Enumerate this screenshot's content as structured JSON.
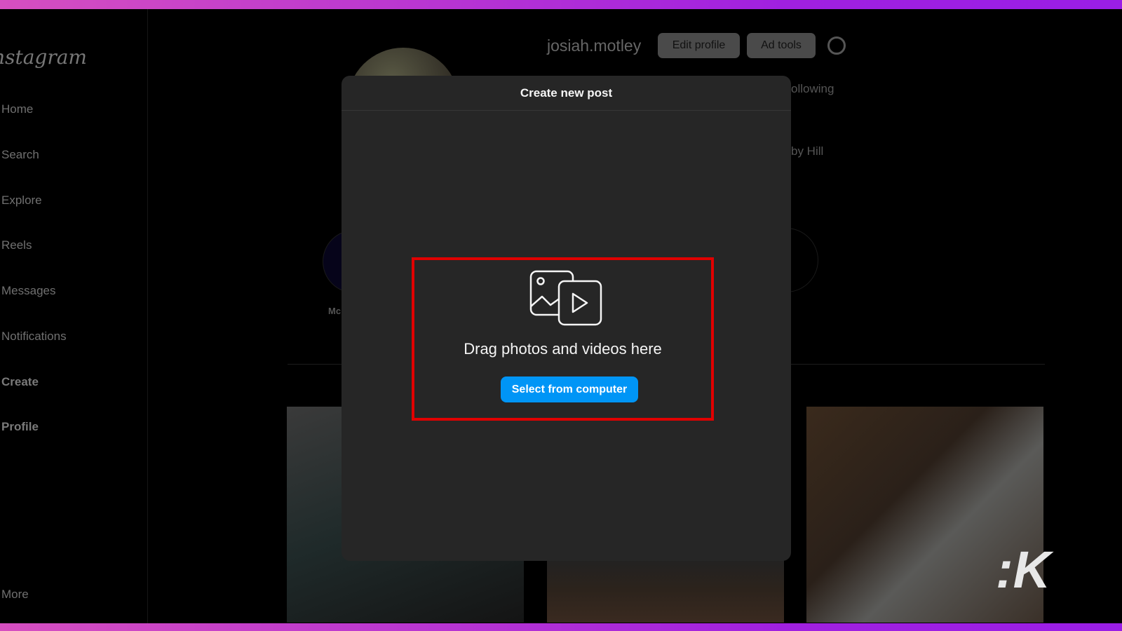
{
  "sidebar": {
    "logo": "Instagram",
    "items": [
      {
        "label": "Home"
      },
      {
        "label": "Search"
      },
      {
        "label": "Explore"
      },
      {
        "label": "Reels"
      },
      {
        "label": "Messages"
      },
      {
        "label": "Notifications"
      },
      {
        "label": "Create"
      },
      {
        "label": "Profile"
      }
    ],
    "more": "More"
  },
  "profile": {
    "username": "josiah.motley",
    "edit_profile": "Edit profile",
    "ad_tools": "Ad tools",
    "following_partial": "ollowing",
    "bio_partial": "by Hill",
    "highlight_left_partial": "Mc"
  },
  "modal": {
    "title": "Create new post",
    "drag_text": "Drag photos and videos here",
    "select_button": "Select from computer",
    "highlight_color": "#e00000",
    "button_color": "#0095f6"
  },
  "watermark": "K"
}
